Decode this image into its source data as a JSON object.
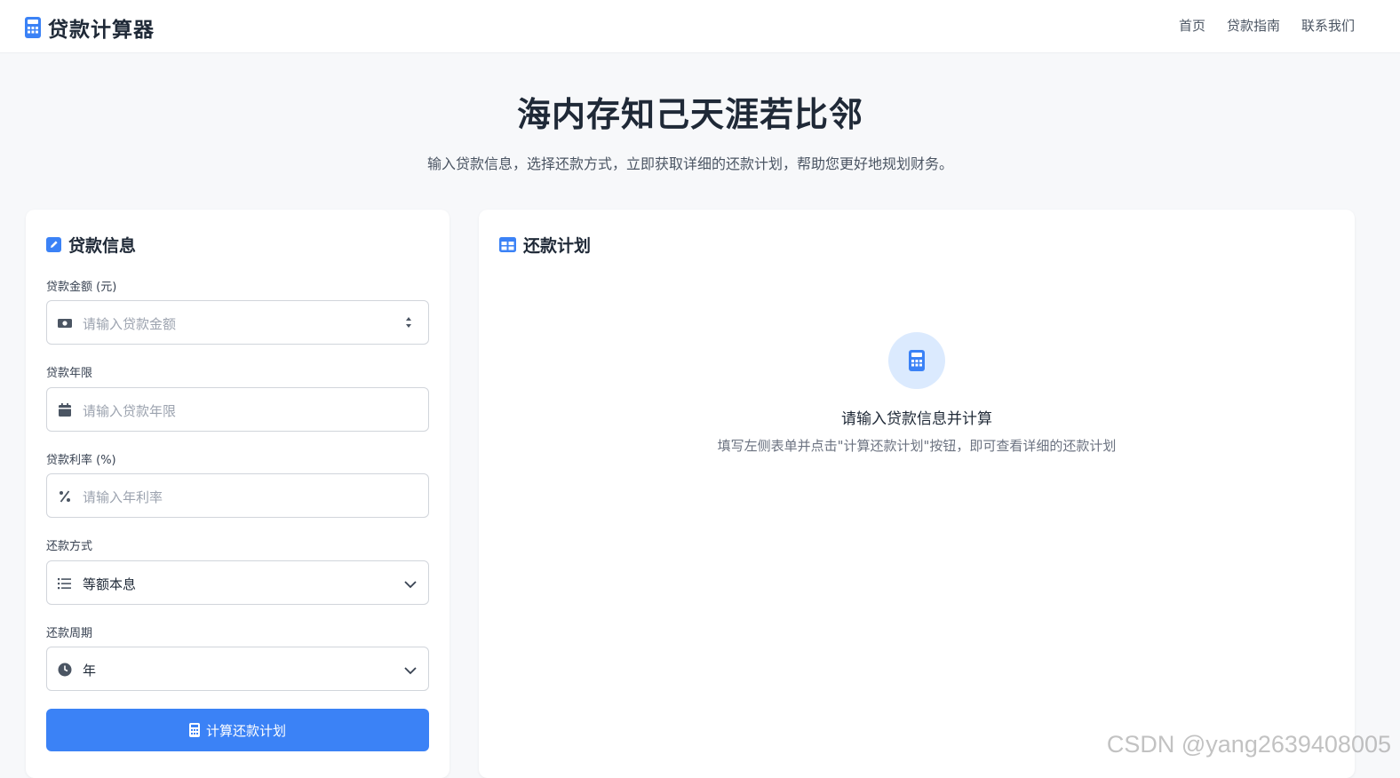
{
  "header": {
    "brand_title": "贷款计算器",
    "nav": [
      "首页",
      "贷款指南",
      "联系我们"
    ]
  },
  "hero": {
    "title": "海内存知己天涯若比邻",
    "subtitle": "输入贷款信息，选择还款方式，立即获取详细的还款计划，帮助您更好地规划财务。"
  },
  "loan_form": {
    "title": "贷款信息",
    "amount": {
      "label": "贷款金额 (元)",
      "placeholder": "请输入贷款金额",
      "icon": "money-icon"
    },
    "term": {
      "label": "贷款年限",
      "placeholder": "请输入贷款年限",
      "icon": "calendar-icon"
    },
    "rate": {
      "label": "贷款利率 (%)",
      "placeholder": "请输入年利率",
      "icon": "percent-icon"
    },
    "method": {
      "label": "还款方式",
      "value": "等额本息",
      "icon": "list-icon"
    },
    "period": {
      "label": "还款周期",
      "value": "年",
      "icon": "clock-icon"
    },
    "submit_label": "计算还款计划"
  },
  "schedule": {
    "title": "还款计划",
    "empty_title": "请输入贷款信息并计算",
    "empty_desc": "填写左侧表单并点击\"计算还款计划\"按钮，即可查看详细的还款计划"
  },
  "watermark": "CSDN @yang2639408005",
  "colors": {
    "primary": "#3b82f6",
    "primary_light": "#dbeafe",
    "text": "#1f2937",
    "muted": "#6b7280"
  }
}
